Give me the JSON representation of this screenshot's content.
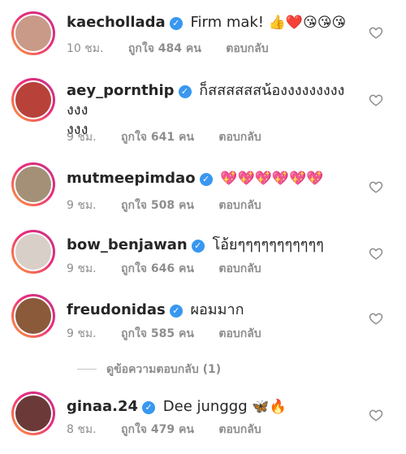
{
  "comments": [
    {
      "username": "kaechollada",
      "text": "Firm mak!",
      "emoji": "👍❤️😘😘😘",
      "time": "10 ชม.",
      "likes": "ถูกใจ 484 คน",
      "reply": "ตอบกลับ",
      "avatar_color": "#c99a88"
    },
    {
      "username": "aey_pornthip",
      "text": "ก็สสสสสสน้องงงงงงงงงงงง",
      "text2": "งงง",
      "time": "9 ชม.",
      "likes": "ถูกใจ 641 คน",
      "reply": "ตอบกลับ",
      "avatar_color": "#b8423a"
    },
    {
      "username": "mutmeepimdao",
      "text": "",
      "emoji": "💖💖💖💖💖💖",
      "time": "9 ชม.",
      "likes": "ถูกใจ 508 คน",
      "reply": "ตอบกลับ",
      "avatar_color": "#a39077"
    },
    {
      "username": "bow_benjawan",
      "text": "โอ้ยๆๆๆๆๆๆๆๆๆๆๆ",
      "time": "9 ชม.",
      "likes": "ถูกใจ 646 คน",
      "reply": "ตอบกลับ",
      "avatar_color": "#d8cfc8"
    },
    {
      "username": "freudonidas",
      "text": "ผอมมาก",
      "time": "9 ชม.",
      "likes": "ถูกใจ 585 คน",
      "reply": "ตอบกลับ",
      "avatar_color": "#8a5a3a"
    },
    {
      "username": "ginaa.24",
      "text": "Dee junggg",
      "emoji": "🦋🔥",
      "time": "8 ชม.",
      "likes": "ถูกใจ 479 คน",
      "reply": "ตอบกลับ",
      "avatar_color": "#6b3a38"
    }
  ],
  "view_replies": "ดูข้อความตอบกลับ (1)",
  "colors": {
    "verified": "#3897f0",
    "meta": "#8e8e8e",
    "text": "#262626"
  }
}
